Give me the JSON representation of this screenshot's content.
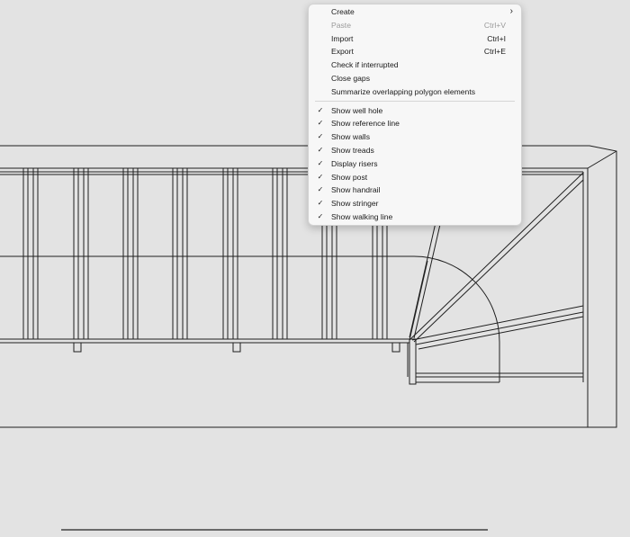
{
  "context_menu": {
    "top_items": [
      {
        "label": "Create",
        "shortcut": "",
        "submenu": true,
        "enabled": true,
        "name": "menu-item-create"
      },
      {
        "label": "Paste",
        "shortcut": "Ctrl+V",
        "submenu": false,
        "enabled": false,
        "name": "menu-item-paste"
      },
      {
        "label": "Import",
        "shortcut": "Ctrl+I",
        "submenu": false,
        "enabled": true,
        "name": "menu-item-import"
      },
      {
        "label": "Export",
        "shortcut": "Ctrl+E",
        "submenu": false,
        "enabled": true,
        "name": "menu-item-export"
      },
      {
        "label": "Check if interrupted",
        "shortcut": "",
        "submenu": false,
        "enabled": true,
        "name": "menu-item-check-if-interrupted"
      },
      {
        "label": "Close gaps",
        "shortcut": "",
        "submenu": false,
        "enabled": true,
        "name": "menu-item-close-gaps"
      },
      {
        "label": "Summarize overlapping polygon elements",
        "shortcut": "",
        "submenu": false,
        "enabled": true,
        "name": "menu-item-summarize-overlapping"
      }
    ],
    "toggle_items": [
      {
        "label": "Show well hole",
        "checked": true,
        "name": "menu-item-show-well-hole"
      },
      {
        "label": "Show reference line",
        "checked": true,
        "name": "menu-item-show-reference-line"
      },
      {
        "label": "Show walls",
        "checked": true,
        "name": "menu-item-show-walls"
      },
      {
        "label": "Show treads",
        "checked": true,
        "name": "menu-item-show-treads"
      },
      {
        "label": "Display risers",
        "checked": true,
        "name": "menu-item-display-risers"
      },
      {
        "label": "Show post",
        "checked": true,
        "name": "menu-item-show-post"
      },
      {
        "label": "Show handrail",
        "checked": true,
        "name": "menu-item-show-handrail"
      },
      {
        "label": "Show stringer",
        "checked": true,
        "name": "menu-item-show-stringer"
      },
      {
        "label": "Show walking line",
        "checked": true,
        "name": "menu-item-show-walking-line"
      }
    ],
    "check_glyph": "✓",
    "submenu_glyph": "›"
  },
  "colors": {
    "canvas_background": "#e3e3e3",
    "drawing_line": "#1f1f1f",
    "menu_background": "#f7f7f7"
  }
}
